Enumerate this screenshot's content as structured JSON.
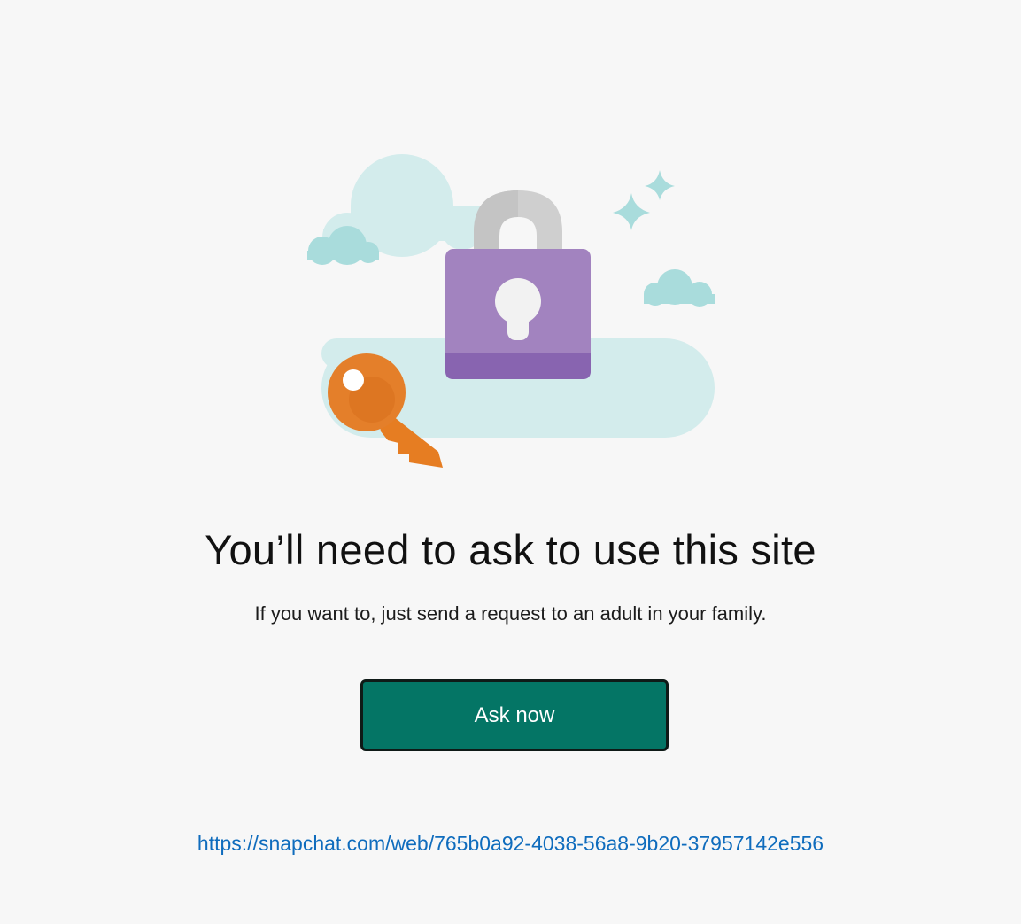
{
  "heading": "You’ll need to ask to use this site",
  "subtext": "If you want to, just send a request to an adult in your family.",
  "button": {
    "label": "Ask now",
    "color": "#047565"
  },
  "blocked_url": "https://snapchat.com/web/765b0a92-4038-56a8-9b20-37957142e556",
  "colors": {
    "background": "#f7f7f7",
    "link": "#0f6cbd",
    "lock_body": "#a283bf",
    "key": "#e77e25",
    "cloud": "#a9dcdc"
  },
  "illustration": {
    "icons": [
      "cloud-icon",
      "padlock-icon",
      "key-icon",
      "sparkle-icon"
    ]
  }
}
